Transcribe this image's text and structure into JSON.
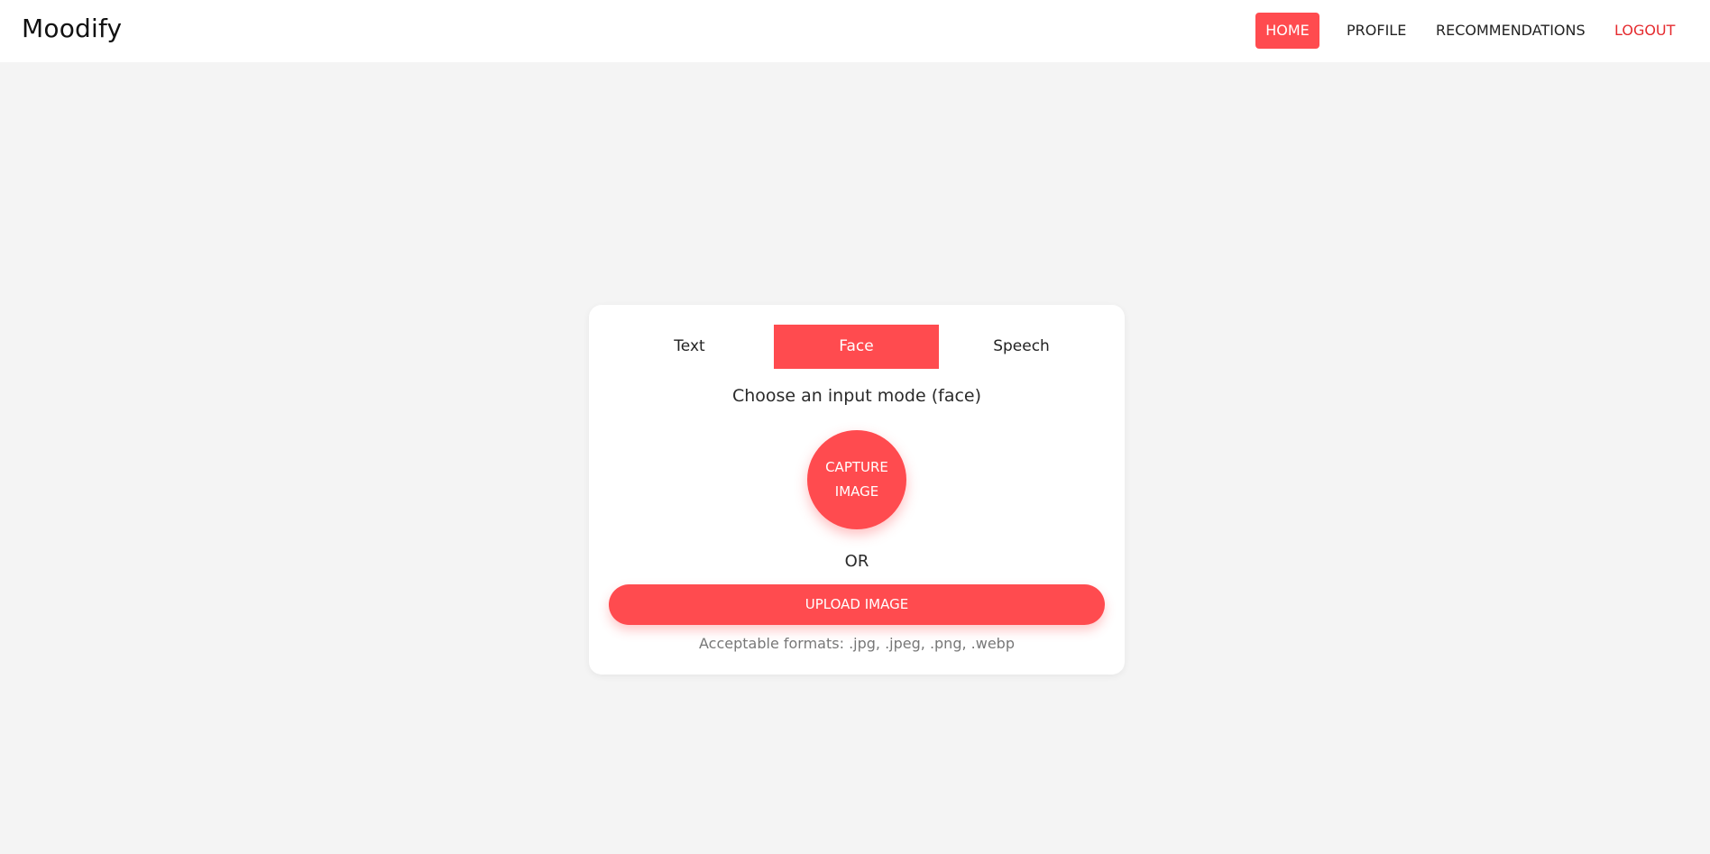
{
  "app": {
    "brand": "Moodify"
  },
  "nav": {
    "home": "HOME",
    "profile": "PROFILE",
    "recommendations": "RECOMMENDATIONS",
    "logout": "LOGOUT",
    "active": "HOME"
  },
  "mode_tabs": {
    "items": [
      "Text",
      "Face",
      "Speech"
    ],
    "active": "Face"
  },
  "card": {
    "title": "Choose an input mode (face)",
    "capture_line1": "CAPTURE",
    "capture_line2": "IMAGE",
    "or": "OR",
    "upload": "UPLOAD IMAGE",
    "formats": "Acceptable formats: .jpg, .jpeg, .png, .webp"
  },
  "colors": {
    "accent": "#ff4b4f",
    "logout": "#e52b2f",
    "background": "#f4f4f4"
  }
}
